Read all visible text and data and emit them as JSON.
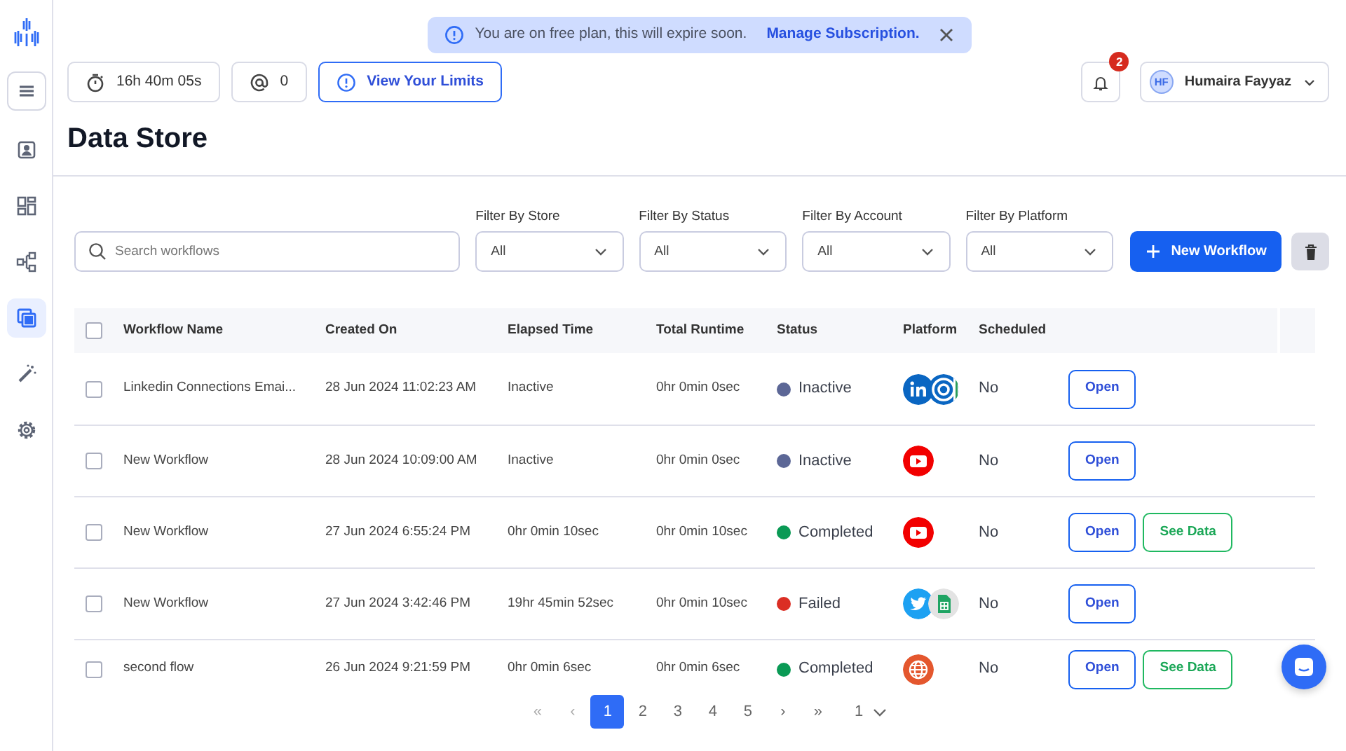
{
  "sidebar": {
    "items": [
      {
        "kind": "menu",
        "selected": false
      },
      {
        "kind": "contacts",
        "selected": false
      },
      {
        "kind": "dashboard",
        "selected": false
      },
      {
        "kind": "workflow",
        "selected": false
      },
      {
        "kind": "datastore",
        "selected": true
      },
      {
        "kind": "magic",
        "selected": false
      },
      {
        "kind": "settings",
        "selected": false
      }
    ]
  },
  "alert": {
    "message": "You are on free plan, this will expire soon.",
    "link": "Manage Subscription."
  },
  "toolbar": {
    "timer": "16h 40m 05s",
    "mentions": "0",
    "limits_button": "View Your Limits"
  },
  "notifications": {
    "count": "2"
  },
  "user": {
    "initials": "HF",
    "name": "Humaira Fayyaz"
  },
  "page_title": "Data Store",
  "search": {
    "placeholder": "Search workflows"
  },
  "filters": [
    {
      "label": "Filter By Store",
      "value": "All"
    },
    {
      "label": "Filter By Status",
      "value": "All"
    },
    {
      "label": "Filter By Account",
      "value": "All"
    },
    {
      "label": "Filter By Platform",
      "value": "All"
    }
  ],
  "new_button": "New Workflow",
  "table": {
    "select_all_checked": false,
    "columns": [
      "Workflow Name",
      "Created On",
      "Elapsed Time",
      "Total Runtime",
      "Status",
      "Platform",
      "Scheduled"
    ],
    "rows": [
      {
        "checked": false,
        "name": "Linkedin Connections Emai...",
        "created": "28 Jun 2024 11:02:23 AM",
        "elapsed": "Inactive",
        "runtime": "0hr 0min 0sec",
        "status": {
          "text": "Inactive",
          "color": "#5c6796"
        },
        "platforms": [
          {
            "kind": "linkedin"
          },
          {
            "kind": "target"
          }
        ],
        "scheduled": "No",
        "open_button": "Open"
      },
      {
        "checked": false,
        "name": "New Workflow",
        "created": "28 Jun 2024 10:09:00 AM",
        "elapsed": "Inactive",
        "runtime": "0hr 0min 0sec",
        "status": {
          "text": "Inactive",
          "color": "#5c6796"
        },
        "platforms": [
          {
            "kind": "youtube"
          }
        ],
        "scheduled": "No",
        "open_button": "Open"
      },
      {
        "checked": false,
        "name": "New Workflow",
        "created": "27 Jun 2024 6:55:24 PM",
        "elapsed": "0hr 0min 10sec",
        "runtime": "0hr 0min 10sec",
        "status": {
          "text": "Completed",
          "color": "#0a9a55"
        },
        "platforms": [
          {
            "kind": "youtube"
          }
        ],
        "scheduled": "No",
        "open_button": "Open",
        "see_data_button": "See Data"
      },
      {
        "checked": false,
        "name": "New Workflow",
        "created": "27 Jun 2024 3:42:46 PM",
        "elapsed": "19hr 45min 52sec",
        "runtime": "0hr 0min 10sec",
        "status": {
          "text": "Failed",
          "color": "#db2e24"
        },
        "platforms": [
          {
            "kind": "twitter"
          },
          {
            "kind": "sheets"
          }
        ],
        "scheduled": "No",
        "open_button": "Open"
      },
      {
        "checked": false,
        "name": "second flow",
        "created": "26 Jun 2024 9:21:59 PM",
        "elapsed": "0hr 0min 6sec",
        "runtime": "0hr 0min 6sec",
        "status": {
          "text": "Completed",
          "color": "#0a9a55"
        },
        "platforms": [
          {
            "kind": "web"
          }
        ],
        "scheduled": "No",
        "open_button": "Open",
        "see_data_button": "See Data"
      }
    ]
  },
  "pagination": {
    "first": "«",
    "prev": "‹",
    "pages": [
      {
        "label": "1",
        "selected": true
      },
      {
        "label": "2",
        "selected": false
      },
      {
        "label": "3",
        "selected": false
      },
      {
        "label": "4",
        "selected": false
      },
      {
        "label": "5",
        "selected": false
      }
    ],
    "next": "›",
    "last": "»",
    "page_select": "1"
  }
}
